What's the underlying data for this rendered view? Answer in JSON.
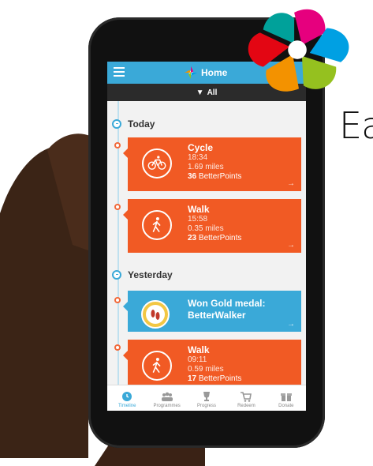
{
  "side_text": "Ea",
  "app": {
    "title": "Home",
    "filter_label": "All"
  },
  "sections": {
    "today": "Today",
    "yesterday": "Yesterday"
  },
  "activities": [
    {
      "title": "Cycle",
      "time": "18:34",
      "distance": "1.69 miles",
      "points": "36",
      "points_label": "BetterPoints",
      "icon": "bicycle-icon"
    },
    {
      "title": "Walk",
      "time": "15:58",
      "distance": "0.35 miles",
      "points": "23",
      "points_label": "BetterPoints",
      "icon": "walking-icon"
    }
  ],
  "medal": {
    "line1": "Won Gold medal:",
    "line2": "BetterWalker",
    "icon": "gold-medal-icon"
  },
  "yesterday_activity": {
    "title": "Walk",
    "time": "09:11",
    "distance": "0.59 miles",
    "points": "17",
    "points_label": "BetterPoints",
    "icon": "walking-icon"
  },
  "nav": [
    {
      "label": "Timeline",
      "icon": "timeline-icon",
      "active": true
    },
    {
      "label": "Programmes",
      "icon": "people-icon"
    },
    {
      "label": "Progress",
      "icon": "trophy-icon"
    },
    {
      "label": "Redeem",
      "icon": "cart-icon"
    },
    {
      "label": "Donate",
      "icon": "gift-icon"
    }
  ],
  "colors": {
    "accent_blue": "#3aa9d8",
    "activity_orange": "#f15a24",
    "header_dark": "#2b2b2b"
  }
}
